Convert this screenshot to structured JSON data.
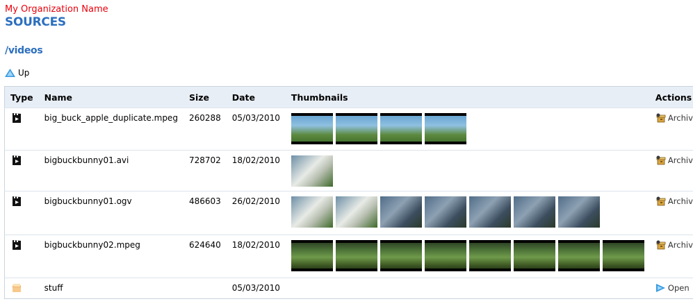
{
  "header": {
    "organization": "My Organization Name",
    "title": "SOURCES",
    "path": "/videos",
    "up_label": "Up"
  },
  "table": {
    "columns": [
      "Type",
      "Name",
      "Size",
      "Date",
      "Thumbnails",
      "Actions"
    ],
    "rows": [
      {
        "type_icon": "movie-icon",
        "name": "big_buck_apple_duplicate.mpeg",
        "size": "260288",
        "date": "05/03/2010",
        "thumb_style": "sky",
        "thumb_count": 4,
        "action": "Archive",
        "action_icon": "archive-icon"
      },
      {
        "type_icon": "movie-icon",
        "name": "bigbuckbunny01.avi",
        "size": "728702",
        "date": "18/02/2010",
        "thumb_style": "closeup",
        "thumb_count": 1,
        "action": "Archive",
        "action_icon": "archive-icon"
      },
      {
        "type_icon": "movie-icon",
        "name": "bigbuckbunny01.ogv",
        "size": "486603",
        "date": "26/02/2010",
        "thumb_style": "mixed",
        "thumb_count": 7,
        "action": "Archive",
        "action_icon": "archive-icon"
      },
      {
        "type_icon": "movie-icon",
        "name": "bigbuckbunny02.mpeg",
        "size": "624640",
        "date": "18/02/2010",
        "thumb_style": "forest",
        "thumb_count": 8,
        "action": "Archive",
        "action_icon": "archive-icon"
      },
      {
        "type_icon": "folder-icon",
        "name": "stuff",
        "size": "",
        "date": "05/03/2010",
        "thumb_style": "",
        "thumb_count": 0,
        "action": "Open",
        "action_icon": "open-arrow-icon"
      }
    ]
  }
}
